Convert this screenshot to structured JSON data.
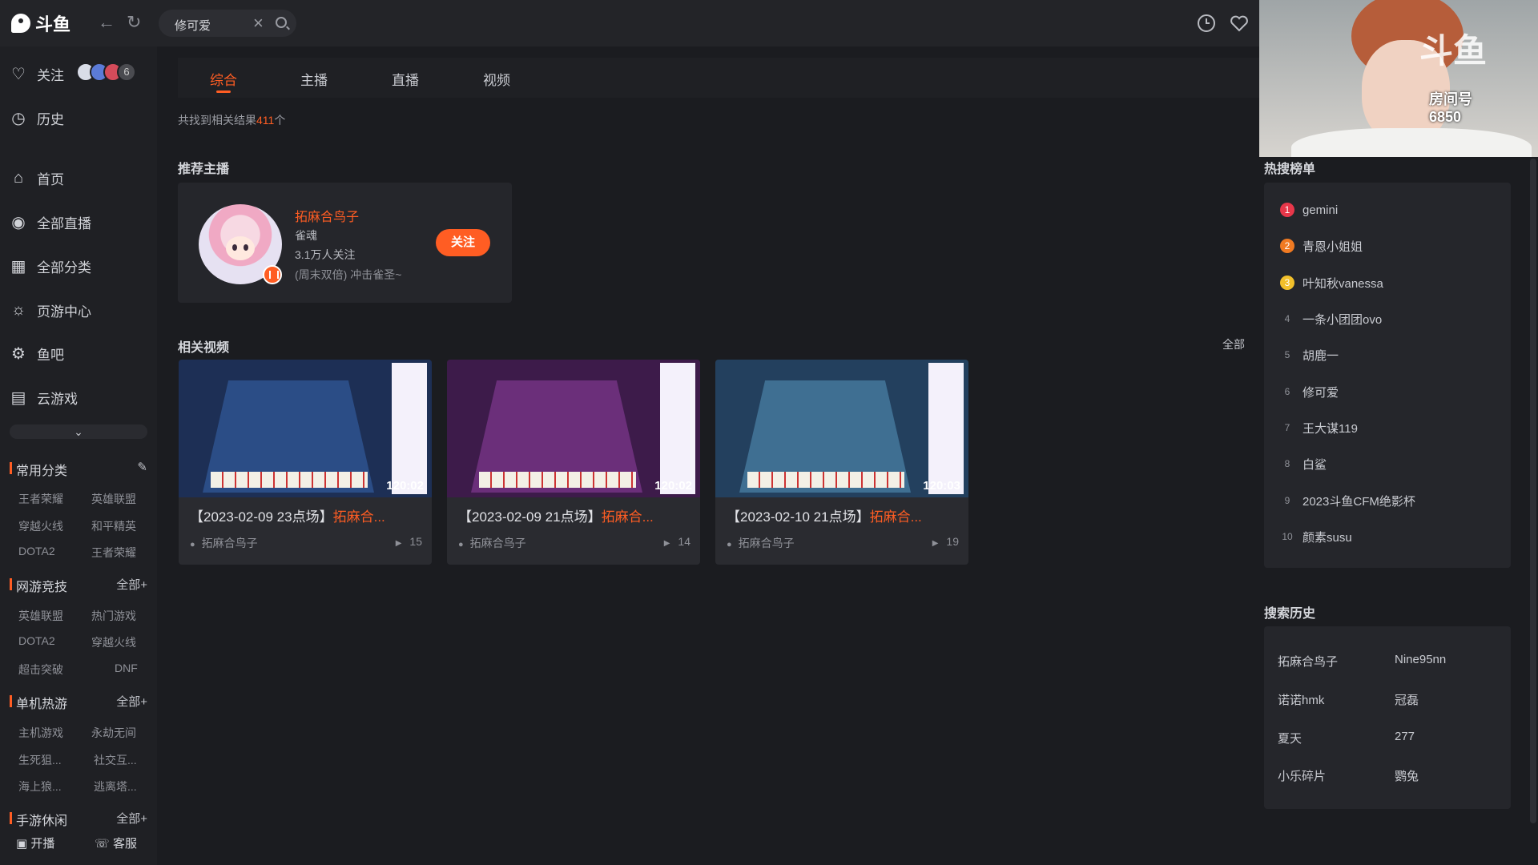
{
  "header": {
    "logo_text": "斗鱼",
    "search_value": "修可爱",
    "back_icon": "arrow-left-icon",
    "refresh_icon": "refresh-icon",
    "history_icon": "clock-icon",
    "follow_icon": "heart-icon"
  },
  "sidebar": {
    "top_items": [
      {
        "label": "关注",
        "icon": "heart-icon"
      },
      {
        "label": "历史",
        "icon": "clock-icon"
      }
    ],
    "followed_count": "6",
    "nav_items": [
      {
        "label": "首页",
        "icon": "home-icon"
      },
      {
        "label": "全部直播",
        "icon": "live-icon"
      },
      {
        "label": "全部分类",
        "icon": "grid-icon"
      },
      {
        "label": "页游中心",
        "icon": "game-center-icon"
      },
      {
        "label": "鱼吧",
        "icon": "fishbar-icon"
      },
      {
        "label": "云游戏",
        "icon": "gamepad-icon"
      }
    ],
    "sections": [
      {
        "title": "常用分类",
        "more": "",
        "items": [
          "王者荣耀",
          "英雄联盟",
          "穿越火线",
          "和平精英",
          "DOTA2",
          "王者荣耀"
        ]
      },
      {
        "title": "网游竞技",
        "more": "全部+",
        "items": [
          "英雄联盟",
          "热门游戏",
          "DOTA2",
          "穿越火线",
          "超击突破",
          "DNF"
        ]
      },
      {
        "title": "单机热游",
        "more": "全部+",
        "items": [
          "主机游戏",
          "永劫无间",
          "生死狙...",
          "社交互...",
          "海上狼...",
          "逃离塔..."
        ]
      },
      {
        "title": "手游休闲",
        "more": "全部+",
        "items": []
      }
    ],
    "bottom": {
      "broadcast": "开播",
      "service": "客服"
    }
  },
  "tabs": [
    {
      "label": "综合",
      "active": true
    },
    {
      "label": "主播",
      "active": false
    },
    {
      "label": "直播",
      "active": false
    },
    {
      "label": "视频",
      "active": false
    }
  ],
  "results": {
    "prefix": "共找到相关结果",
    "count": "411",
    "suffix": "个"
  },
  "recommend": {
    "title": "推荐主播",
    "name": "拓麻合鸟子",
    "category": "雀魂",
    "followers": "3.1万人关注",
    "desc": "(周末双倍) 冲击雀圣~",
    "follow_label": "关注"
  },
  "videos": {
    "title": "相关视频",
    "all_label": "全部",
    "items": [
      {
        "title_prefix": "【2023-02-09 23点场】",
        "title_hl": "拓麻合...",
        "duration": "120:02",
        "author": "拓麻合鸟子",
        "views": "15",
        "table_color": "#2b4d86"
      },
      {
        "title_prefix": "【2023-02-09 21点场】",
        "title_hl": "拓麻合...",
        "duration": "120:02",
        "author": "拓麻合鸟子",
        "views": "14",
        "table_color": "#6b2f7a"
      },
      {
        "title_prefix": "【2023-02-10 21点场】",
        "title_hl": "拓麻合...",
        "duration": "120:03",
        "author": "拓麻合鸟子",
        "views": "19",
        "table_color": "#3f6f92"
      }
    ]
  },
  "stream_overlay": {
    "mark": "斗鱼",
    "room": "房间号",
    "room_no": "6850"
  },
  "hot": {
    "title": "热搜榜单",
    "items": [
      {
        "rank": "1",
        "label": "gemini",
        "color": "#e8374a"
      },
      {
        "rank": "2",
        "label": "青恩小姐姐",
        "color": "#f07a22"
      },
      {
        "rank": "3",
        "label": "叶知秋vanessa",
        "color": "#f2c02b"
      },
      {
        "rank": "4",
        "label": "一条小团团ovo",
        "color": ""
      },
      {
        "rank": "5",
        "label": "胡鹿一",
        "color": ""
      },
      {
        "rank": "6",
        "label": "修可爱",
        "color": ""
      },
      {
        "rank": "7",
        "label": "王大谋119",
        "color": ""
      },
      {
        "rank": "8",
        "label": "白鲨",
        "color": ""
      },
      {
        "rank": "9",
        "label": "2023斗鱼CFM绝影杯",
        "color": ""
      },
      {
        "rank": "10",
        "label": "颜素susu",
        "color": ""
      }
    ]
  },
  "history": {
    "title": "搜索历史",
    "items": [
      "拓麻合鸟子",
      "Nine95nn",
      "诺诺hmk",
      "冠磊",
      "夏天",
      "277",
      "小乐碎片",
      "鹦兔"
    ]
  },
  "colors": {
    "accent": "#ff5d23",
    "bg": "#1b1c20",
    "panel": "#25262b"
  }
}
